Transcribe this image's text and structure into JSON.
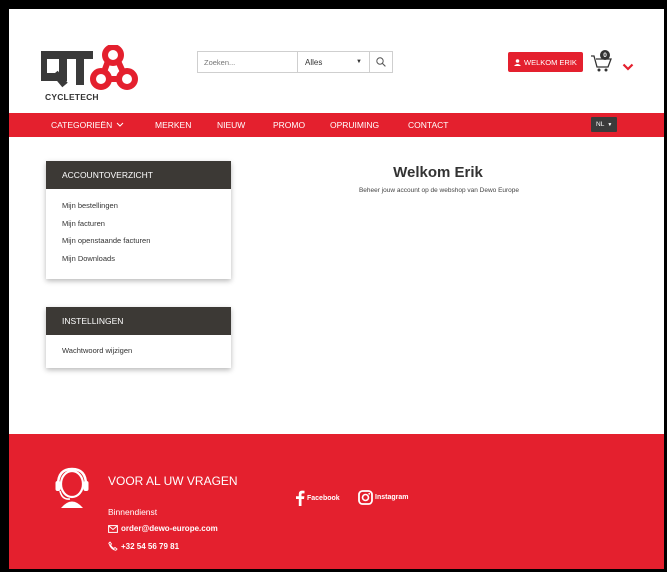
{
  "header": {
    "logo_text": "CYCLETECH",
    "search": {
      "placeholder": "Zoeken...",
      "category": "Alles"
    },
    "welcome_label": "WELKOM ERIK",
    "cart_count": "0"
  },
  "nav": {
    "items": [
      "CATEGORIEËN",
      "MERKEN",
      "NIEUW",
      "PROMO",
      "OPRUIMING",
      "CONTACT"
    ],
    "language": "NL"
  },
  "account_panel": {
    "title": "ACCOUNTOVERZICHT",
    "links": [
      "Mijn bestellingen",
      "Mijn facturen",
      "Mijn openstaande facturen",
      "Mijn Downloads"
    ]
  },
  "settings_panel": {
    "title": "INSTELLINGEN",
    "links": [
      "Wachtwoord wijzigen"
    ]
  },
  "main": {
    "title": "Welkom Erik",
    "subtitle": "Beheer jouw account op de webshop van Dewo Europe"
  },
  "footer": {
    "title": "VOOR AL UW VRAGEN",
    "department": "Binnendienst",
    "email": "order@dewo-europe.com",
    "phone": "+32 54 56 79 81",
    "social": [
      "Facebook",
      "Instagram"
    ]
  },
  "colors": {
    "brand_red": "#e4202e",
    "panel_dark": "#3c3935",
    "lang_bg": "#3b3b3b"
  }
}
